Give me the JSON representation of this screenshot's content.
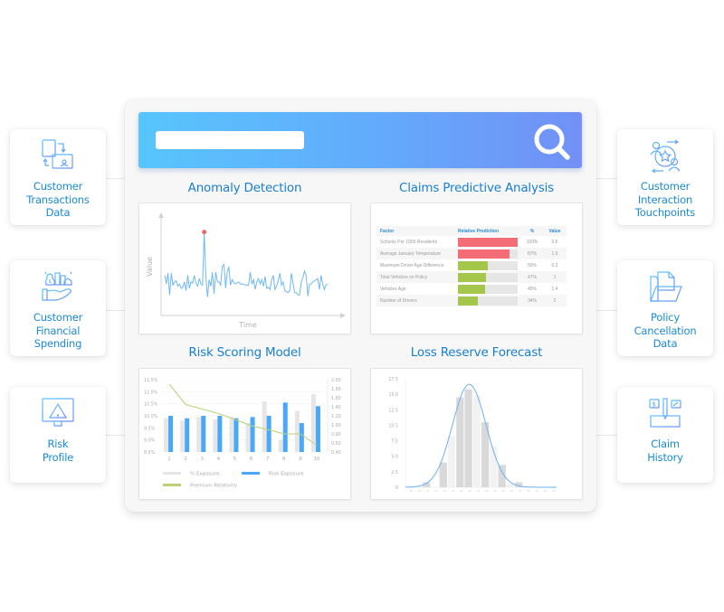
{
  "search": {
    "placeholder": "",
    "value": ""
  },
  "colors": {
    "accent": "#1a8ad4",
    "search_gradient_start": "#58c5fd",
    "search_gradient_end": "#7290f6",
    "anomaly_line": "#6fb8f6",
    "anomaly_marker": "#f2646c",
    "bar_red": "#f46c75",
    "bar_green": "#a4c64b",
    "risk_exposure": "#4aa8f8",
    "pct_exposure": "#e6e6e6",
    "premium_line": "#b9d27a",
    "histogram_bar": "#d9d9d9",
    "histogram_curve": "#6ab2f4"
  },
  "left_cards": [
    {
      "label": "Customer\nTransactions\nData",
      "icon": "server-transfer-icon"
    },
    {
      "label": "Customer\nFinancial\nSpending",
      "icon": "hand-money-buildings-icon"
    },
    {
      "label": "Risk\nProfile",
      "icon": "monitor-warning-icon"
    }
  ],
  "right_cards": [
    {
      "label": "Customer\nInteraction\nTouchpoints",
      "icon": "people-star-cycle-icon"
    },
    {
      "label": "Policy\nCancellation\nData",
      "icon": "folder-document-icon"
    },
    {
      "label": "Claim\nHistory",
      "icon": "claim-documents-pencil-icon"
    }
  ],
  "panels": {
    "anomaly": {
      "title": "Anomaly Detection",
      "xlabel": "Time",
      "ylabel": "Value"
    },
    "claims": {
      "title": "Claims Predictive Analysis",
      "headers": [
        "Factor",
        "Relative Prediction",
        "%",
        "Value"
      ],
      "rows": [
        {
          "factor": "Schools Per 1000 Residents",
          "pct": 100,
          "pct_label": "100%",
          "value": "3.5",
          "color": "red"
        },
        {
          "factor": "Average January Temperature",
          "pct": 87,
          "pct_label": "87%",
          "value": "1.5",
          "color": "red"
        },
        {
          "factor": "Maximum Driver Age Difference",
          "pct": 50,
          "pct_label": "50%",
          "value": "0.2",
          "color": "green"
        },
        {
          "factor": "Total Vehicles on Policy",
          "pct": 47,
          "pct_label": "47%",
          "value": "1",
          "color": "green"
        },
        {
          "factor": "Vehicles  Age",
          "pct": 45,
          "pct_label": "45%",
          "value": "1.4",
          "color": "green"
        },
        {
          "factor": "Number of Drivers",
          "pct": 34,
          "pct_label": "34%",
          "value": "2",
          "color": "green"
        }
      ]
    },
    "risk": {
      "title": "Risk Scoring Model"
    },
    "loss": {
      "title": "Loss Reserve Forecast"
    }
  },
  "chart_data": [
    {
      "type": "line",
      "title": "Anomaly Detection",
      "xlabel": "Time",
      "ylabel": "Value",
      "anomaly_index": 17,
      "values": [
        42,
        34,
        44,
        24,
        44,
        33,
        36,
        37,
        32,
        34,
        30,
        31,
        36,
        28,
        42,
        30,
        36,
        35,
        42,
        35,
        32,
        39,
        34,
        33,
        82,
        40,
        22,
        38,
        32,
        45,
        25,
        45,
        36,
        36,
        33,
        50,
        52,
        30,
        45,
        50,
        33,
        38,
        35,
        34,
        35,
        36,
        34,
        34,
        34,
        33,
        33,
        33,
        45,
        34,
        38,
        29,
        36,
        39,
        34,
        38,
        32,
        41,
        30,
        31,
        29,
        38,
        42,
        29,
        32,
        37,
        44,
        33,
        36,
        28,
        27,
        26,
        28,
        44,
        35,
        26,
        26,
        24,
        24,
        36,
        40,
        46,
        41,
        23,
        34,
        34,
        36,
        37,
        38,
        39,
        29,
        42,
        34,
        29,
        33,
        34
      ],
      "anomaly": {
        "x": 24,
        "y": 82
      }
    },
    {
      "type": "bar",
      "title": "Risk Scoring Model",
      "categories": [
        "1",
        "2",
        "3",
        "4",
        "5",
        "6",
        "7",
        "8",
        "9",
        "10"
      ],
      "series": [
        {
          "name": "% Exposure",
          "axis": "left",
          "values": [
            9.9,
            9.8,
            9.95,
            9.85,
            9.95,
            9.7,
            10.6,
            9.0,
            10.2,
            10.9
          ]
        },
        {
          "name": "Risk Exposure",
          "axis": "left",
          "values": [
            10.0,
            9.9,
            10.0,
            10.0,
            9.9,
            9.95,
            10.0,
            10.55,
            9.7,
            10.4
          ]
        },
        {
          "name": "Premium Relativity",
          "type": "line",
          "axis": "right",
          "values": [
            1.9,
            1.45,
            1.35,
            1.25,
            1.12,
            0.98,
            0.9,
            0.8,
            0.8,
            0.55
          ]
        }
      ],
      "y_left_ticks": [
        "11.5%",
        "11.0%",
        "10.5%",
        "10.0%",
        "9.5%",
        "9.0%",
        "8.5%"
      ],
      "y_left_range": [
        8.5,
        11.5
      ],
      "y_right_ticks": [
        "2.00",
        "1.80",
        "1.60",
        "1.40",
        "1.20",
        "1.00",
        "0.90",
        "0.50",
        "0.40"
      ],
      "y_right_range": [
        0.4,
        2.0
      ],
      "legend": [
        "% Exposure",
        "Risk Exposure",
        "Premium Relativity"
      ],
      "legend_position": "bottom"
    },
    {
      "type": "bar",
      "title": "Loss Reserve Forecast",
      "subtype": "histogram-with-normal-curve",
      "y_ticks": [
        "17.5",
        "15.0",
        "12.5",
        "10.5",
        "7.5",
        "5.0",
        "2.5",
        "0"
      ],
      "y_range": [
        0,
        17.5
      ],
      "bins": 18,
      "values": [
        0,
        0.2,
        0.8,
        0,
        4.0,
        8.3,
        14.5,
        15.8,
        14.8,
        10.5,
        6.5,
        3.6,
        0.6,
        0.8,
        0,
        0,
        0,
        0
      ],
      "highlight_bars": [
        0,
        0,
        1,
        0,
        1,
        0,
        1,
        1,
        0,
        1,
        0,
        1,
        0,
        1,
        0,
        0,
        0,
        0
      ],
      "curve": {
        "mean_bin": 7.6,
        "sd_bins": 2.0,
        "peak": 16.6
      }
    }
  ]
}
